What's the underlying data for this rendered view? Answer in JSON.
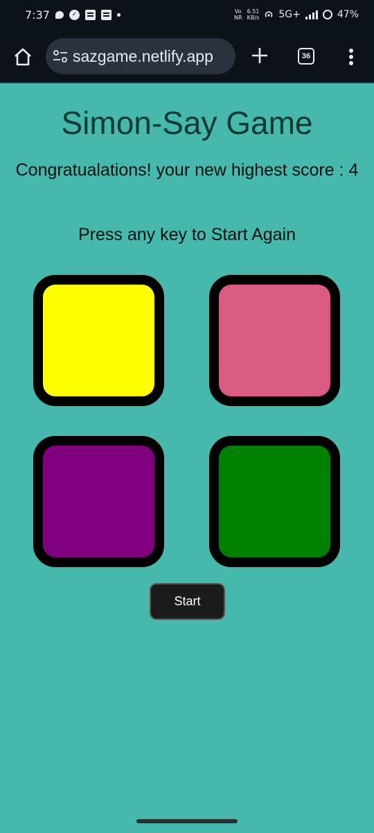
{
  "status_bar": {
    "time": "7:37",
    "network_top": "Vo",
    "network_bottom": "NR",
    "speed_value": "6.51",
    "speed_unit": "KB/s",
    "signal": "5G+",
    "battery": "47%"
  },
  "browser": {
    "url": "sazgame.netlify.app",
    "tab_count": "36"
  },
  "page": {
    "title": "Simon-Say Game",
    "score_message": "Congratualations! your new highest score : 4",
    "restart_prompt": "Press any key to Start Again",
    "start_button": "Start"
  },
  "game_buttons": [
    {
      "name": "yellow",
      "color": "#ffff00"
    },
    {
      "name": "red",
      "color": "#db5c82"
    },
    {
      "name": "purple",
      "color": "#800080"
    },
    {
      "name": "green",
      "color": "#008000"
    }
  ],
  "colors": {
    "page_background": "#46b8ac",
    "title": "#0f3a33",
    "chrome_background": "#0d1219"
  }
}
